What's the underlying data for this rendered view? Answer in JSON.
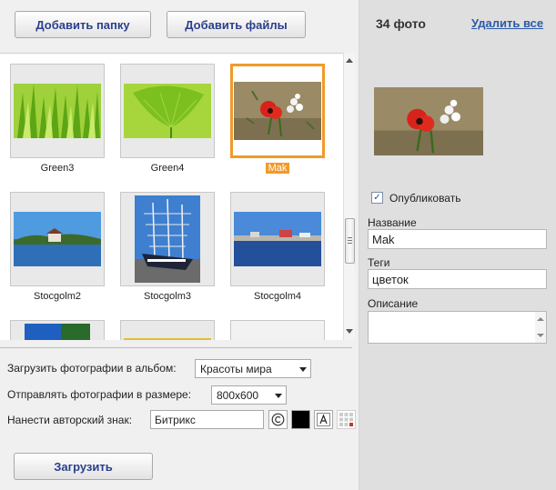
{
  "toolbar": {
    "add_folder": "Добавить папку",
    "add_files": "Добавить файлы"
  },
  "photos": [
    {
      "name": "Green3",
      "icon": "grass-photo"
    },
    {
      "name": "Green4",
      "icon": "ginkgo-leaf-photo"
    },
    {
      "name": "Mak",
      "icon": "poppy-photo",
      "selected": true
    },
    {
      "name": "Stocgolm2",
      "icon": "lake-house-photo"
    },
    {
      "name": "Stocgolm3",
      "icon": "tall-ship-photo"
    },
    {
      "name": "Stocgolm4",
      "icon": "harbor-photo"
    }
  ],
  "options": {
    "album_label": "Загрузить фотографии в альбом:",
    "album_value": "Красоты мира",
    "size_label": "Отправлять фотографии в размере:",
    "size_value": "800x600",
    "watermark_label": "Нанести авторский знак:",
    "watermark_value": "Битрикс"
  },
  "upload_button": "Загрузить",
  "right": {
    "count": "34 фото",
    "delete_all": "Удалить все",
    "publish_label": "Опубликовать",
    "publish_checked": true,
    "title_label": "Название",
    "title_value": "Mak",
    "tags_label": "Теги",
    "tags_value": "цветок",
    "desc_label": "Описание"
  },
  "colors": {
    "accent": "#f09a2a",
    "button_text": "#2b3f8c",
    "link": "#2b5aa8"
  }
}
